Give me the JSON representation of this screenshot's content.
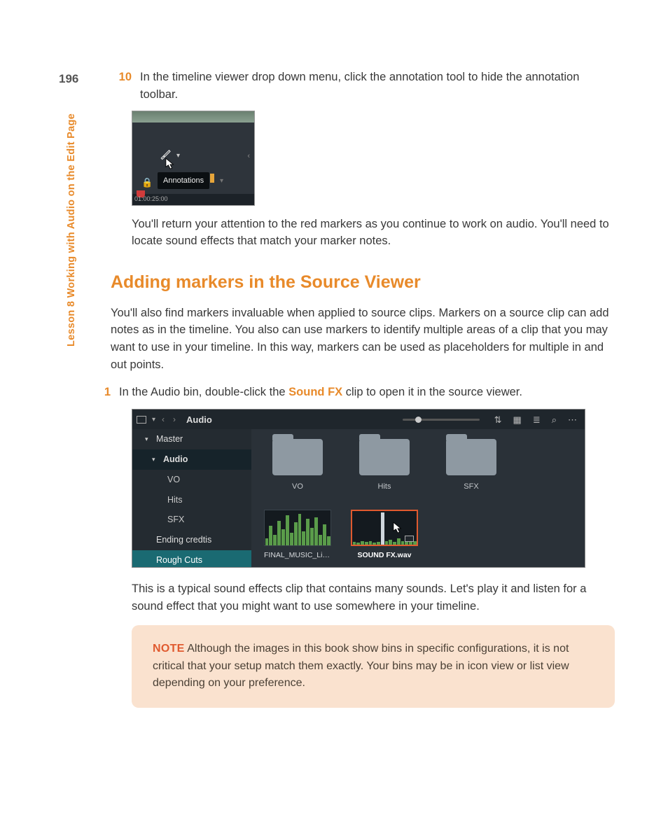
{
  "page_number": "196",
  "side_label": "Lesson 8   Working with Audio on the Edit Page",
  "step10_num": "10",
  "step10_text": "In the timeline viewer drop down menu, click the annotation tool to hide the annotation toolbar.",
  "shot1": {
    "tooltip": "Annotations",
    "timecode": "01:00:25:00"
  },
  "para_after_shot1": "You'll return your attention to the red markers as you continue to work on audio. You'll need to locate sound effects that match your marker notes.",
  "section_heading": "Adding markers in the Source Viewer",
  "section_intro": "You'll also find markers invaluable when applied to source clips. Markers on a source clip can add notes as in the timeline. You also can use markers to identify multiple areas of a clip that you may want to use in your timeline. In this way, markers can be used as placeholders for multiple in and out points.",
  "step1_num": "1",
  "step1_pre": "In the Audio bin, double-click the ",
  "step1_bold": "Sound FX",
  "step1_post": " clip to open it in the source viewer.",
  "shot2": {
    "breadcrumb": "Audio",
    "tree": {
      "master": "Master",
      "audio": "Audio",
      "vo": "VO",
      "hits": "Hits",
      "sfx": "SFX",
      "ending": "Ending credtis",
      "rough": "Rough Cuts"
    },
    "folders": {
      "vo": "VO",
      "hits": "Hits",
      "sfx": "SFX"
    },
    "clips": {
      "music": "FINAL_MUSIC_Living...",
      "soundfx": "SOUND FX.wav"
    }
  },
  "para_after_shot2": "This is a typical sound effects clip that contains many sounds. Let's play it and listen for a sound effect that you might want to use somewhere in your timeline.",
  "note_label": "NOTE",
  "note_text": "  Although the images in this book show bins in specific configurations, it is not critical that your setup match them exactly. Your bins may be in icon view or list view depending on your preference."
}
